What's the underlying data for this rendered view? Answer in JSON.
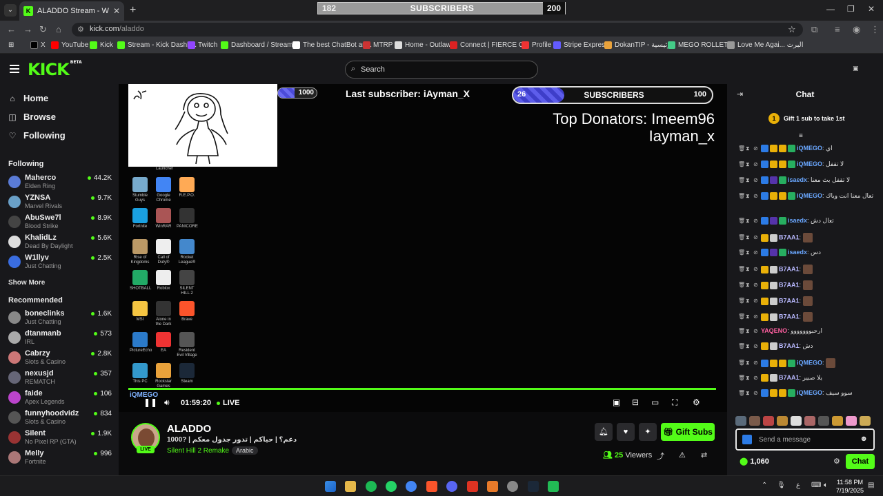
{
  "browser": {
    "tab_title": "ALADDO Stream - Watch Li",
    "url_domain": "kick.com",
    "url_path": "/aladdo",
    "bookmarks": [
      "X",
      "YouTube",
      "Kick",
      "Stream - Kick Dashb...",
      "Twitch",
      "Dashboard / Stream...",
      "The best ChatBot an...",
      "MTRP",
      "Home - Outlaw",
      "Connect | FIERCE G...",
      "Profile",
      "Stripe Express",
      "DokanTIP - الرئيسية",
      "MEGO ROLLETE",
      "Love Me Agai... البرت"
    ]
  },
  "overlay_top": {
    "left": "182",
    "center": "SUBSCRIBERS",
    "right": "200"
  },
  "header": {
    "logo": "KICK",
    "logo_badge": "BETA",
    "search_placeholder": "Search"
  },
  "sidebar": {
    "nav": [
      "Home",
      "Browse",
      "Following"
    ],
    "following_heading": "Following",
    "following": [
      {
        "name": "Maherco",
        "category": "Elden Ring",
        "viewers": "44.2K",
        "color": "#5a7bd6"
      },
      {
        "name": "YZNSA",
        "category": "Marvel Rivals",
        "viewers": "9.7K",
        "color": "#6aa0c8"
      },
      {
        "name": "AbuSwe7l",
        "category": "Blood Strike",
        "viewers": "8.9K",
        "color": "#444"
      },
      {
        "name": "KhalidLz",
        "category": "Dead By Daylight",
        "viewers": "5.6K",
        "color": "#ddd"
      },
      {
        "name": "W1llyv",
        "category": "Just Chatting",
        "viewers": "2.5K",
        "color": "#3a6de0"
      }
    ],
    "show_more": "Show More",
    "recommended_heading": "Recommended",
    "recommended": [
      {
        "name": "boneclinks",
        "category": "Just Chatting",
        "viewers": "1.6K",
        "color": "#888"
      },
      {
        "name": "dtanmanb",
        "category": "IRL",
        "viewers": "573",
        "color": "#aaa"
      },
      {
        "name": "Cabrzy",
        "category": "Slots & Casino",
        "viewers": "2.8K",
        "color": "#c77"
      },
      {
        "name": "nexusjd",
        "category": "REMATCH",
        "viewers": "357",
        "color": "#667"
      },
      {
        "name": "faide",
        "category": "Apex Legends",
        "viewers": "106",
        "color": "#b4c"
      },
      {
        "name": "funnyhoodvidz",
        "category": "Slots & Casino",
        "viewers": "834",
        "color": "#555"
      },
      {
        "name": "Silent",
        "category": "No Pixel RP (GTA)",
        "viewers": "1.9K",
        "color": "#933"
      },
      {
        "name": "Melly",
        "category": "Fortnite",
        "viewers": "996",
        "color": "#a77"
      }
    ]
  },
  "video": {
    "mini_sub_count": "1000",
    "last_subscriber": "Last subscriber: iAyman_X",
    "sub_goal": {
      "current": "26",
      "label": "SUBSCRIBERS",
      "goal": "100"
    },
    "donators_line1": "Top Donators: Imeem96",
    "donators_line2": "Iayman_x",
    "launcher_label": "Launcher",
    "desktop_icons": [
      "Stumble Guys",
      "Google Chrome",
      "R.E.P.O.",
      "Fortnite",
      "WinRAR",
      "PANICORE",
      "Rise of Kingdoms",
      "Call of Duty®",
      "Rocket League®",
      "SHOTBALL",
      "Roblox",
      "SILENT HILL 2",
      "MSI",
      "Alone in the Dark",
      "Brave",
      "PictureEcho",
      "EA",
      "Resident Evil Village",
      "This PC",
      "Rockstar Games",
      "Steam"
    ],
    "chat_overlay_user": "iQMEGO",
    "time": "01:59:20",
    "live_label": "LIVE"
  },
  "stream": {
    "name": "ALADDO",
    "live_badge": "LIVE",
    "title": "1000? | دعم؟ | حياكم | تدور جدول معكم",
    "category": "Silent Hill 2 Remake",
    "language": "Arabic",
    "gift_label": "Gift Subs",
    "viewers_count": "25",
    "viewers_label": "Viewers"
  },
  "chat": {
    "title": "Chat",
    "gift_banner": "Gift 1 sub to take 1st",
    "gift_rank": "1",
    "messages": [
      {
        "user": "iQMEGO",
        "color": "#6aa7ff",
        "text": "اي"
      },
      {
        "user": "iQMEGO",
        "color": "#6aa7ff",
        "text": "لا تقفل"
      },
      {
        "user": "isaedx",
        "color": "#6aa7ff",
        "text": "لا تقفل بث معنا"
      },
      {
        "user": "iQMEGO",
        "color": "#6aa7ff",
        "text": "تعال معنا انت وياك"
      },
      {
        "user": "isaedx",
        "color": "#6aa7ff",
        "text": "تعال دش"
      },
      {
        "user": "B7AA1",
        "color": "#b9b9ff",
        "text": ""
      },
      {
        "user": "isaedx",
        "color": "#6aa7ff",
        "text": "دس"
      },
      {
        "user": "B7AA1",
        "color": "#b9b9ff",
        "text": ""
      },
      {
        "user": "B7AA1",
        "color": "#b9b9ff",
        "text": ""
      },
      {
        "user": "B7AA1",
        "color": "#b9b9ff",
        "text": ""
      },
      {
        "user": "B7AA1",
        "color": "#b9b9ff",
        "text": ""
      },
      {
        "user": "YAQENO",
        "color": "#ff5fa0",
        "text": "ارحبووووووو"
      },
      {
        "user": "B7AA1",
        "color": "#b9b9ff",
        "text": "دش"
      },
      {
        "user": "iQMEGO",
        "color": "#6aa7ff",
        "text": ""
      },
      {
        "user": "B7AA1",
        "color": "#b9b9ff",
        "text": "يلا صبير"
      },
      {
        "user": "iQMEGO",
        "color": "#6aa7ff",
        "text": "سوو سيف"
      }
    ],
    "input_placeholder": "Send a message",
    "points": "1,060",
    "send_label": "Chat"
  },
  "taskbar": {
    "time": "11:58 PM",
    "date": "7/19/2025",
    "lang": "ع"
  }
}
